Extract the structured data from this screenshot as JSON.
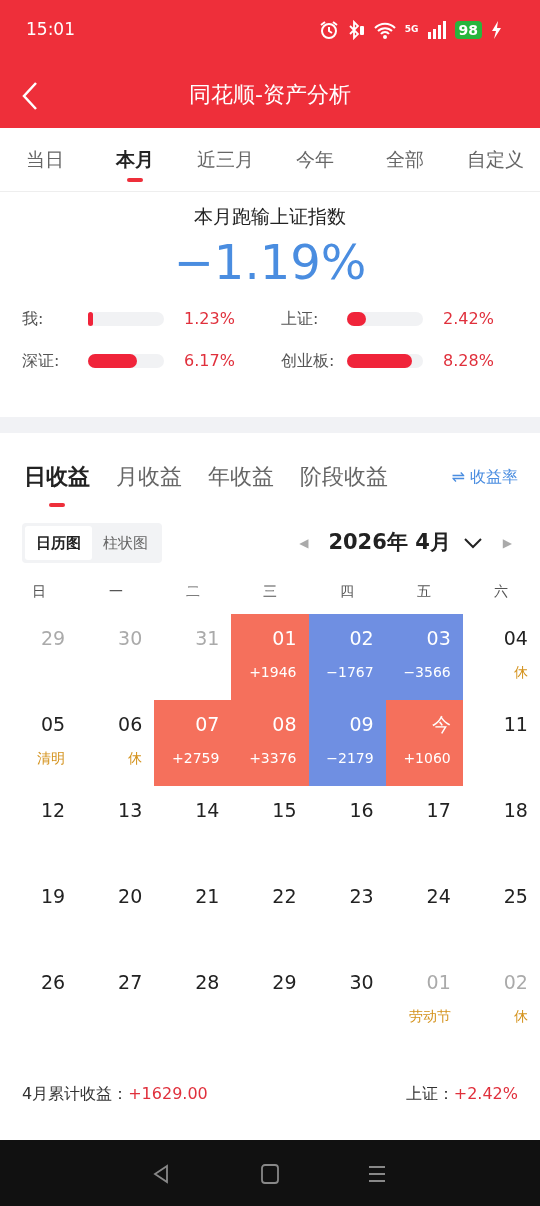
{
  "status_bar": {
    "time": "15:01",
    "network": "5G",
    "battery": "98"
  },
  "header": {
    "title": "同花顺-资产分析"
  },
  "period_tabs": [
    {
      "label": "当日",
      "selected": false
    },
    {
      "label": "本月",
      "selected": true
    },
    {
      "label": "近三月",
      "selected": false
    },
    {
      "label": "今年",
      "selected": false
    },
    {
      "label": "全部",
      "selected": false
    },
    {
      "label": "自定义",
      "selected": false
    }
  ],
  "summary": {
    "caption": "本月跑输上证指数",
    "value": "−1.19%",
    "bars": [
      {
        "label": "我:",
        "level": 0.06,
        "reading": "1.23%"
      },
      {
        "label": "上证:",
        "level": 0.25,
        "reading": "2.42%"
      },
      {
        "label": "深证:",
        "level": 0.64,
        "reading": "6.17%"
      },
      {
        "label": "创业板:",
        "level": 0.86,
        "reading": "8.28%"
      }
    ]
  },
  "profit_tabs": [
    {
      "label": "日收益",
      "selected": true
    },
    {
      "label": "月收益",
      "selected": false
    },
    {
      "label": "年收益",
      "selected": false
    },
    {
      "label": "阶段收益",
      "selected": false
    }
  ],
  "rate_toggle": {
    "icon": "⇌",
    "label": "收益率"
  },
  "view_toggle": [
    {
      "label": "日历图",
      "selected": true
    },
    {
      "label": "柱状图",
      "selected": false
    }
  ],
  "month_picker": {
    "prev": "◀",
    "label": "2026年 4月",
    "next": "▶"
  },
  "calendar": {
    "weekdays": [
      "日",
      "一",
      "二",
      "三",
      "四",
      "五",
      "六"
    ],
    "weeks": [
      [
        {
          "day": "29",
          "kind": "outside"
        },
        {
          "day": "30",
          "kind": "outside"
        },
        {
          "day": "31",
          "kind": "outside"
        },
        {
          "day": "01",
          "note": "+1946",
          "kind": "gain"
        },
        {
          "day": "02",
          "note": "−1767",
          "kind": "loss"
        },
        {
          "day": "03",
          "note": "−3566",
          "kind": "loss"
        },
        {
          "day": "04",
          "note": "休",
          "kind": "normal"
        }
      ],
      [
        {
          "day": "05",
          "note": "清明",
          "kind": "normal"
        },
        {
          "day": "06",
          "note": "休",
          "kind": "normal"
        },
        {
          "day": "07",
          "note": "+2759",
          "kind": "gain"
        },
        {
          "day": "08",
          "note": "+3376",
          "kind": "gain"
        },
        {
          "day": "09",
          "note": "−2179",
          "kind": "loss"
        },
        {
          "day": "今",
          "note": "+1060",
          "kind": "gain"
        },
        {
          "day": "11",
          "kind": "normal"
        }
      ],
      [
        {
          "day": "12",
          "kind": "normal"
        },
        {
          "day": "13",
          "kind": "normal"
        },
        {
          "day": "14",
          "kind": "normal"
        },
        {
          "day": "15",
          "kind": "normal"
        },
        {
          "day": "16",
          "kind": "normal"
        },
        {
          "day": "17",
          "kind": "normal"
        },
        {
          "day": "18",
          "kind": "normal"
        }
      ],
      [
        {
          "day": "19",
          "kind": "normal"
        },
        {
          "day": "20",
          "kind": "normal"
        },
        {
          "day": "21",
          "kind": "normal"
        },
        {
          "day": "22",
          "kind": "normal"
        },
        {
          "day": "23",
          "kind": "normal"
        },
        {
          "day": "24",
          "kind": "normal"
        },
        {
          "day": "25",
          "kind": "normal"
        }
      ],
      [
        {
          "day": "26",
          "kind": "normal"
        },
        {
          "day": "27",
          "kind": "normal"
        },
        {
          "day": "28",
          "kind": "normal"
        },
        {
          "day": "29",
          "kind": "normal"
        },
        {
          "day": "30",
          "kind": "normal"
        },
        {
          "day": "01",
          "note": "劳动节",
          "kind": "outside"
        },
        {
          "day": "02",
          "note": "休",
          "kind": "outside"
        }
      ]
    ]
  },
  "footer": {
    "total_label": "4月累计收益：",
    "total_value": "+1629.00",
    "index_label": "上证：",
    "index_value": "+2.42%"
  }
}
